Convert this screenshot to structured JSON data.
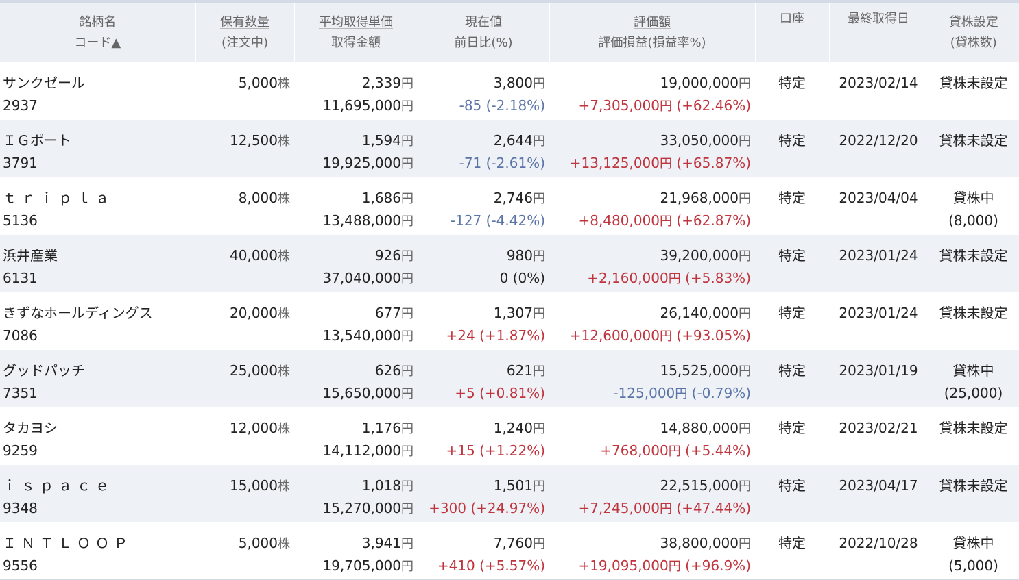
{
  "headers": {
    "name": [
      "銘柄名",
      "コード▲"
    ],
    "qty": [
      "保有数量",
      "(注文中)"
    ],
    "avg": [
      "平均取得単価",
      "取得金額"
    ],
    "price": [
      "現在値",
      "前日比(%)"
    ],
    "value": [
      "評価額",
      "評価損益(損益率%)"
    ],
    "account": "口座",
    "date": "最終取得日",
    "lending": [
      "貸株設定",
      "(貸株数)"
    ]
  },
  "unit_shares": "株",
  "unit_yen": "円",
  "colors": {
    "positive": "#c0343e",
    "negative": "#5b74a8",
    "header_bg": "#eceff4",
    "stripe_bg": "#eef1f5"
  },
  "rows": [
    {
      "name": "サンクゼール",
      "code": "2937",
      "qty": "5,000",
      "avg": "2,339",
      "cost": "11,695,000",
      "price": "3,800",
      "change": "-85 (-2.18%)",
      "change_dir": "neg",
      "value": "19,000,000",
      "pl_amount": "+7,305,000",
      "pl_rate": "(+62.46%)",
      "pl_dir": "pos",
      "account": "特定",
      "date": "2023/02/14",
      "lending": "貸株未設定",
      "lending_qty": ""
    },
    {
      "name": "ＩＧポート",
      "code": "3791",
      "qty": "12,500",
      "avg": "1,594",
      "cost": "19,925,000",
      "price": "2,644",
      "change": "-71 (-2.61%)",
      "change_dir": "neg",
      "value": "33,050,000",
      "pl_amount": "+13,125,000",
      "pl_rate": "(+65.87%)",
      "pl_dir": "pos",
      "account": "特定",
      "date": "2022/12/20",
      "lending": "貸株未設定",
      "lending_qty": ""
    },
    {
      "name": "ｔｒｉｐｌａ",
      "code": "5136",
      "qty": "8,000",
      "avg": "1,686",
      "cost": "13,488,000",
      "price": "2,746",
      "change": "-127 (-4.42%)",
      "change_dir": "neg",
      "value": "21,968,000",
      "pl_amount": "+8,480,000",
      "pl_rate": "(+62.87%)",
      "pl_dir": "pos",
      "account": "特定",
      "date": "2023/04/04",
      "lending": "貸株中",
      "lending_qty": "(8,000)"
    },
    {
      "name": "浜井産業",
      "code": "6131",
      "qty": "40,000",
      "avg": "926",
      "cost": "37,040,000",
      "price": "980",
      "change": "0 (0%)",
      "change_dir": "zero",
      "value": "39,200,000",
      "pl_amount": "+2,160,000",
      "pl_rate": "(+5.83%)",
      "pl_dir": "pos",
      "account": "特定",
      "date": "2023/01/24",
      "lending": "貸株未設定",
      "lending_qty": ""
    },
    {
      "name": "きずなホールディングス",
      "code": "7086",
      "qty": "20,000",
      "avg": "677",
      "cost": "13,540,000",
      "price": "1,307",
      "change": "+24 (+1.87%)",
      "change_dir": "pos",
      "value": "26,140,000",
      "pl_amount": "+12,600,000",
      "pl_rate": "(+93.05%)",
      "pl_dir": "pos",
      "account": "特定",
      "date": "2023/01/24",
      "lending": "貸株未設定",
      "lending_qty": ""
    },
    {
      "name": "グッドパッチ",
      "code": "7351",
      "qty": "25,000",
      "avg": "626",
      "cost": "15,650,000",
      "price": "621",
      "change": "+5 (+0.81%)",
      "change_dir": "pos",
      "value": "15,525,000",
      "pl_amount": "-125,000",
      "pl_rate": "(-0.79%)",
      "pl_dir": "neg",
      "account": "特定",
      "date": "2023/01/19",
      "lending": "貸株中",
      "lending_qty": "(25,000)"
    },
    {
      "name": "タカヨシ",
      "code": "9259",
      "qty": "12,000",
      "avg": "1,176",
      "cost": "14,112,000",
      "price": "1,240",
      "change": "+15 (+1.22%)",
      "change_dir": "pos",
      "value": "14,880,000",
      "pl_amount": "+768,000",
      "pl_rate": "(+5.44%)",
      "pl_dir": "pos",
      "account": "特定",
      "date": "2023/02/21",
      "lending": "貸株未設定",
      "lending_qty": ""
    },
    {
      "name": "ｉｓｐａｃｅ",
      "code": "9348",
      "qty": "15,000",
      "avg": "1,018",
      "cost": "15,270,000",
      "price": "1,501",
      "change": "+300 (+24.97%)",
      "change_dir": "pos",
      "value": "22,515,000",
      "pl_amount": "+7,245,000",
      "pl_rate": "(+47.44%)",
      "pl_dir": "pos",
      "account": "特定",
      "date": "2023/04/17",
      "lending": "貸株未設定",
      "lending_qty": ""
    },
    {
      "name": "ＩＮＴＬＯＯＰ",
      "code": "9556",
      "qty": "5,000",
      "avg": "3,941",
      "cost": "19,705,000",
      "price": "7,760",
      "change": "+410 (+5.57%)",
      "change_dir": "pos",
      "value": "38,800,000",
      "pl_amount": "+19,095,000",
      "pl_rate": "(+96.9%)",
      "pl_dir": "pos",
      "account": "特定",
      "date": "2022/10/28",
      "lending": "貸株中",
      "lending_qty": "(5,000)"
    }
  ]
}
